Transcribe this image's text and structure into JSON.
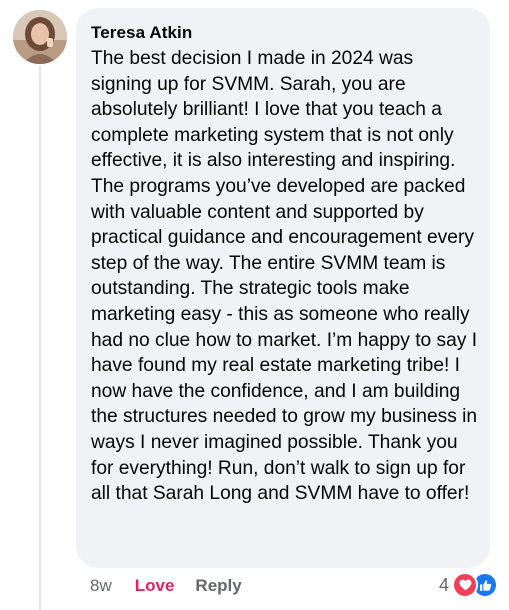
{
  "comment": {
    "author": "Teresa Atkin",
    "text": "The best decision I made in 2024 was signing up for SVMM. Sarah, you are absolutely brilliant! I love that you teach a complete marketing system that is not only effective, it is also interesting and inspiring. The programs you’ve developed are packed with valuable content and supported by practical guidance and encouragement every step of the way. The entire SVMM team is outstanding. The strategic tools make marketing easy - this as someone who really had no clue how to market.  I’m happy to say I have found my real estate marketing tribe! I now have the confidence, and I am building the structures needed to grow my business in ways I never imagined possible. Thank you for everything! Run, don’t walk to sign up for all that Sarah Long and SVMM have to offer!",
    "timestamp": "8w",
    "love_label": "Love",
    "reply_label": "Reply",
    "reaction_count": "4",
    "reactions": [
      "heart-icon",
      "like-icon"
    ]
  },
  "colors": {
    "bubble": "#f0f2f5",
    "love": "#e0245e",
    "heart_reaction": "#f33e58",
    "like_reaction": "#1877f2",
    "secondary_text": "#65676b"
  }
}
